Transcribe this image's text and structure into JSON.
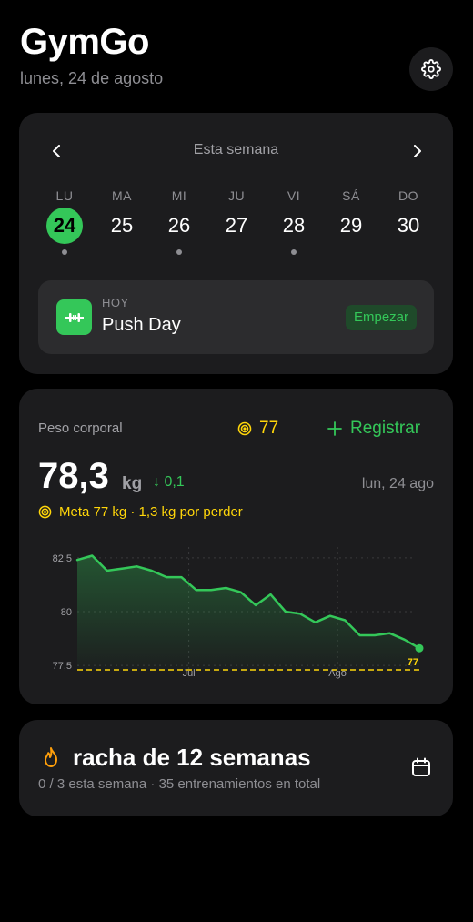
{
  "header": {
    "title": "GymGo",
    "date": "lunes, 24 de agosto"
  },
  "week": {
    "title": "Esta semana",
    "days": [
      {
        "letter": "LU",
        "num": "24",
        "active": true,
        "dot": true
      },
      {
        "letter": "MA",
        "num": "25",
        "active": false,
        "dot": false
      },
      {
        "letter": "MI",
        "num": "26",
        "active": false,
        "dot": true
      },
      {
        "letter": "JU",
        "num": "27",
        "active": false,
        "dot": false
      },
      {
        "letter": "VI",
        "num": "28",
        "active": false,
        "dot": true
      },
      {
        "letter": "SÁ",
        "num": "29",
        "active": false,
        "dot": false
      },
      {
        "letter": "DO",
        "num": "30",
        "active": false,
        "dot": false
      }
    ],
    "today": {
      "label": "HOY",
      "name": "Push Day",
      "button": "Empezar"
    }
  },
  "weight": {
    "title": "Peso corporal",
    "goal": "77",
    "register": "Registrar",
    "value": "78,3",
    "unit": "kg",
    "delta": "↓ 0,1",
    "date": "lun, 24 ago",
    "meta": "Meta 77 kg · 1,3 kg por perder"
  },
  "chart_data": {
    "type": "area",
    "x": [
      0,
      1,
      2,
      3,
      4,
      5,
      6,
      7,
      8,
      9,
      10,
      11,
      12,
      13,
      14,
      15,
      16,
      17,
      18,
      19,
      20,
      21,
      22,
      23
    ],
    "values": [
      82.4,
      82.6,
      81.9,
      82.0,
      82.1,
      81.9,
      81.6,
      81.6,
      81.0,
      81.0,
      81.1,
      80.9,
      80.3,
      80.8,
      80.0,
      79.9,
      79.5,
      79.8,
      79.6,
      78.9,
      78.9,
      79.0,
      78.7,
      78.3
    ],
    "ylim": [
      77,
      83
    ],
    "yticks": [
      "82,5",
      "80",
      "77,5"
    ],
    "xtick_labels": [
      "Jul",
      "Ago"
    ],
    "goal": 77,
    "goal_label": "77",
    "line_color": "#34c759",
    "goal_color": "#ffd60a"
  },
  "streak": {
    "title": "racha de 12 semanas",
    "sub": "0 / 3 esta semana · 35 entrenamientos en total"
  }
}
